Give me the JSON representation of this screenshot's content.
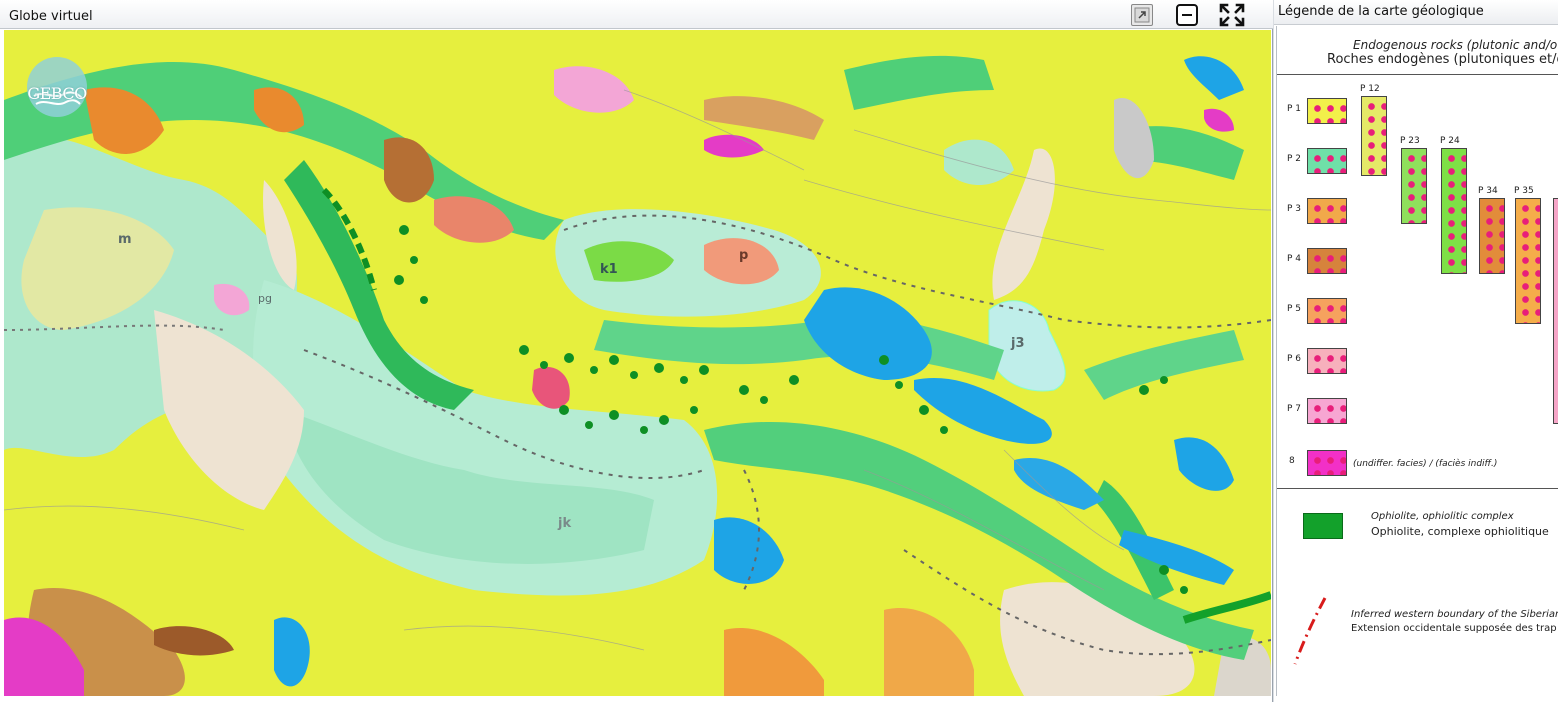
{
  "globe": {
    "title": "Globe virtuel",
    "logo_text": "GEBCO",
    "map_labels": {
      "m": "m",
      "pg": "pg",
      "k1": "k1",
      "p": "p",
      "j3": "j3",
      "jk": "jk"
    },
    "buttons": {
      "dock_icon": "undock-icon",
      "minimize_icon": "minimize-icon",
      "fullscreen_icon": "fullscreen-icon"
    }
  },
  "legend": {
    "title": "Légende de la carte géologique",
    "heading_en": "Endogenous rocks (plutonic and/o",
    "heading_fr": "Roches endogènes (plutoniques et/o",
    "rows": [
      {
        "code": "P 1",
        "color": "#f2f04a"
      },
      {
        "code": "P 2",
        "color": "#6fe0a8"
      },
      {
        "code": "P 3",
        "color": "#f1a94a"
      },
      {
        "code": "P 4",
        "color": "#d6833c"
      },
      {
        "code": "P 5",
        "color": "#f6a25e"
      },
      {
        "code": "P 6",
        "color": "#f7b0bc"
      },
      {
        "code": "P 7",
        "color": "#f7a6d2"
      },
      {
        "code": "8",
        "color": "#f230c7"
      }
    ],
    "columns": [
      {
        "code": "P 12",
        "color": "#e5e967"
      },
      {
        "code": "P 23",
        "color": "#8fe05c"
      },
      {
        "code": "P 24",
        "color": "#7ee046"
      },
      {
        "code": "P 34",
        "color": "#e28c3a"
      },
      {
        "code": "P 35",
        "color": "#f5ad4a"
      }
    ],
    "undiff_text": "(undiffer. facies) / (faciès indiff.)",
    "ophiolite_en": "Ophiolite, ophiolitic complex",
    "ophiolite_fr": "Ophiolite, complexe ophiolitique",
    "trap_en": "Inferred western boundary of the Siberian",
    "trap_fr": "Extension occidentale supposée des trap"
  },
  "colors": {
    "map_yellow": "#e6ef3e",
    "map_mint": "#aee8cc",
    "map_green": "#4fcf78",
    "map_blue": "#1ea4e6",
    "map_beige": "#eee3d2",
    "map_orange": "#e98a2e",
    "map_magenta": "#e43cc6",
    "dot_pink": "#e81e7a",
    "ophiolite_green": "#13a12b"
  }
}
